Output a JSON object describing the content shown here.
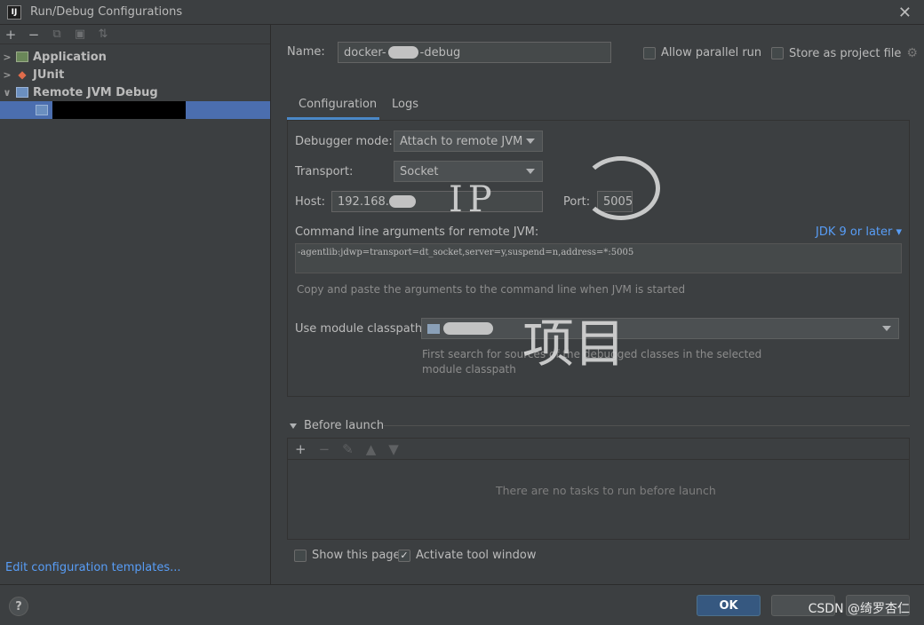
{
  "window": {
    "app_icon": "IJ",
    "title": "Run/Debug Configurations",
    "close_icon": "✕"
  },
  "left": {
    "toolbar": [
      "+",
      "−",
      "⧉",
      "▣",
      "⇅"
    ],
    "tree": [
      {
        "label": "Application",
        "expanded": false
      },
      {
        "label": "JUnit",
        "expanded": false
      },
      {
        "label": "Remote JVM Debug",
        "expanded": true
      }
    ],
    "edit_templates": "Edit configuration templates..."
  },
  "header": {
    "name_label": "Name:",
    "name_value_prefix": "docker-",
    "name_value_suffix": "-debug",
    "allow_parallel_run": "Allow parallel run",
    "store_as_project_file": "Store as project file"
  },
  "tabs": [
    "Configuration",
    "Logs"
  ],
  "config": {
    "debugger_mode_label": "Debugger mode:",
    "debugger_mode_value": "Attach to remote JVM",
    "transport_label": "Transport:",
    "transport_value": "Socket",
    "host_label": "Host:",
    "host_value": "192.168.",
    "port_label": "Port:",
    "port_value": "5005",
    "cmd_label": "Command line arguments for remote JVM:",
    "jdk_link": "JDK 9 or later ▾",
    "cmd_value": "-agentlib:jdwp=transport=dt_socket,server=y,suspend=n,address=*:5005",
    "cmd_hint": "Copy and paste the arguments to the command line when JVM is started",
    "module_label": "Use module classpath:",
    "module_hint_line1": "First search for sources of the debugged classes in the selected",
    "module_hint_line2": "module classpath"
  },
  "annotations": {
    "ip": "IP",
    "project": "项目"
  },
  "before_launch": {
    "title": "Before launch",
    "toolbar": [
      "+",
      "−",
      "✎",
      "▲",
      "▼"
    ],
    "empty_text": "There are no tasks to run before launch"
  },
  "options": {
    "show_this_page": "Show this page",
    "activate_tool_window": "Activate tool window",
    "activate_checked": true
  },
  "buttons": {
    "help": "?",
    "ok": "OK"
  },
  "watermark": "CSDN @绮罗杏仁",
  "colors": {
    "accent": "#4b6eaf",
    "link": "#589df6",
    "ok_button": "#365880"
  }
}
